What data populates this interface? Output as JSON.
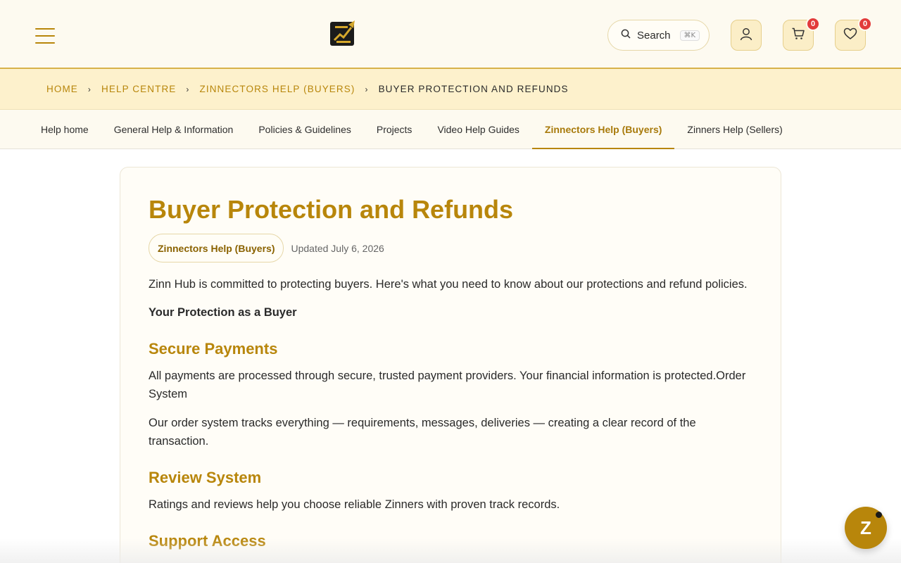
{
  "header": {
    "search_label": "Search",
    "search_shortcut": "⌘K",
    "cart_count": "0",
    "wishlist_count": "0"
  },
  "breadcrumb": {
    "items": [
      "HOME",
      "HELP CENTRE",
      "ZINNECTORS HELP (BUYERS)"
    ],
    "current": "BUYER PROTECTION AND REFUNDS"
  },
  "tabs": [
    {
      "label": "Help home"
    },
    {
      "label": "General Help & Information"
    },
    {
      "label": "Policies & Guidelines"
    },
    {
      "label": "Projects"
    },
    {
      "label": "Video Help Guides"
    },
    {
      "label": "Zinnectors Help (Buyers)",
      "active": true
    },
    {
      "label": "Zinners Help (Sellers)"
    }
  ],
  "article": {
    "title": "Buyer Protection and Refunds",
    "category": "Zinnectors Help (Buyers)",
    "updated": "Updated July 6, 2026",
    "intro": "Zinn Hub is committed to protecting buyers. Here's what you need to know about our protections and refund policies.",
    "protection_heading": "Your Protection as a Buyer",
    "sections": {
      "secure_title": "Secure Payments",
      "secure_text": "All payments are processed through secure, trusted payment providers. Your financial information is protected.Order System",
      "order_text": "Our order system tracks everything — requirements, messages, deliveries — creating a clear record of the transaction.",
      "review_title": "Review System",
      "review_text": "Ratings and reviews help you choose reliable Zinners with proven track records.",
      "support_title": "Support Access"
    }
  },
  "chat": {
    "label": "Z"
  },
  "colors": {
    "accent": "#b8860b",
    "header_bg": "#fdfaf0",
    "breadcrumb_bg": "#fdf1cc",
    "badge": "#e23b3b"
  },
  "icons": [
    "menu-icon",
    "logo-icon",
    "search-icon",
    "user-icon",
    "cart-icon",
    "heart-icon",
    "chevron-right-icon"
  ]
}
